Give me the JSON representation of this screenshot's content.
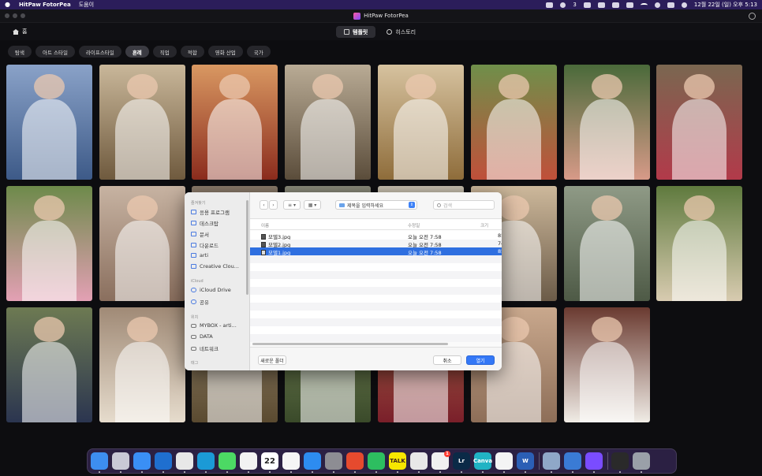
{
  "menubar": {
    "app_name": "HitPaw FotorPea",
    "help_menu": "도움이",
    "badge_count": "3",
    "datetime": "12월 22일 (일) 오후 5:13"
  },
  "titlebar": {
    "title": "HitPaw FotorPea"
  },
  "nav": {
    "home_label": "홈",
    "tabs": [
      {
        "label": "템플릿",
        "active": true
      },
      {
        "label": "히스토리",
        "active": false
      }
    ]
  },
  "categories": [
    {
      "label": "탐색",
      "active": false
    },
    {
      "label": "아트 스타일",
      "active": false
    },
    {
      "label": "라이프스타일",
      "active": false
    },
    {
      "label": "혼례",
      "active": true
    },
    {
      "label": "직업",
      "active": false
    },
    {
      "label": "적합",
      "active": false
    },
    {
      "label": "영화 산업",
      "active": false
    },
    {
      "label": "국가",
      "active": false
    }
  ],
  "templates": [
    {
      "name": "bride-blue-gown-castle",
      "color": "#8aa2c8",
      "accent": "#3d5a88"
    },
    {
      "name": "bride-white-bouquet",
      "color": "#c9b79a",
      "accent": "#6f5a3e"
    },
    {
      "name": "bride-qipao-red",
      "color": "#d99862",
      "accent": "#8b2c1d"
    },
    {
      "name": "bride-lace-hijab",
      "color": "#b9ab95",
      "accent": "#5b4d3b"
    },
    {
      "name": "bride-veil-gold",
      "color": "#d6c29f",
      "accent": "#8f6d3b"
    },
    {
      "name": "bride-garden-bouquet",
      "color": "#6f8f4a",
      "accent": "#c0503a"
    },
    {
      "name": "bride-pink-headwrap",
      "color": "#4a6a3a",
      "accent": "#d79a88"
    },
    {
      "name": "bride-floral-veil",
      "color": "#7a6750",
      "accent": "#b23a4a"
    },
    {
      "name": "bride-pink-hat",
      "color": "#6d8a4a",
      "accent": "#e3a0b4"
    },
    {
      "name": "bride-ballgown-window",
      "color": "#c7b3a2",
      "accent": "#8a6f5e"
    },
    {
      "name": "bride-hidden-1",
      "color": "#8a7a6a",
      "accent": "#4a3a2a"
    },
    {
      "name": "bride-hidden-2",
      "color": "#8a8a7a",
      "accent": "#4a4a3a"
    },
    {
      "name": "bride-hidden-3",
      "color": "#c8c0b0",
      "accent": "#7a6a5a"
    },
    {
      "name": "groom-beige-suit",
      "color": "#cdb89b",
      "accent": "#6b5b48"
    },
    {
      "name": "groom-wedding-guests",
      "color": "#8f9a86",
      "accent": "#4e5a46"
    },
    {
      "name": "groom-garden-tux",
      "color": "#5f7a3e",
      "accent": "#d8cbb0"
    },
    {
      "name": "groom-navy-suit",
      "color": "#6d7a52",
      "accent": "#2b3550"
    },
    {
      "name": "bride-lace-veil-2",
      "color": "#a08a76",
      "accent": "#e6dccd"
    },
    {
      "name": "groom-hidden-4",
      "color": "#9a8a70",
      "accent": "#5a4a30"
    },
    {
      "name": "groom-hidden-5",
      "color": "#7a8a5a",
      "accent": "#3a4a2a"
    },
    {
      "name": "bride-indian-red",
      "color": "#a86a4a",
      "accent": "#7a1f2a"
    },
    {
      "name": "bride-offshoulder-tiara",
      "color": "#c9a88d",
      "accent": "#8d6e58"
    },
    {
      "name": "bride-kimono-temple",
      "color": "#6a3a30",
      "accent": "#f0ece6"
    }
  ],
  "file_dialog": {
    "sidebar": {
      "favorites_header": "즐겨찾기",
      "favorites": [
        "응용 프로그램",
        "데스크탑",
        "문서",
        "다운로드",
        "arti",
        "Creative Clou..."
      ],
      "icloud_header": "iCloud",
      "icloud": [
        "iCloud Drive",
        "공유"
      ],
      "locations_header": "위치",
      "locations": [
        "MYBOX - arti...",
        "DATA",
        "네트워크"
      ],
      "tags_header": "태그"
    },
    "folder_select": "제목을 입력하세요",
    "search_placeholder": "검색",
    "columns": {
      "name": "이름",
      "date": "수정일",
      "size": "크기"
    },
    "files": [
      {
        "name": "모델3.jpg",
        "date": "오늘 오전 7:58",
        "size": "85",
        "selected": false
      },
      {
        "name": "모델2.jpg",
        "date": "오늘 오전 7:58",
        "size": "74",
        "selected": false
      },
      {
        "name": "모델1.jpg",
        "date": "오늘 오전 7:58",
        "size": "85",
        "selected": true
      }
    ],
    "new_folder_button": "새로운 폴더",
    "cancel_button": "취소",
    "open_button": "열기"
  },
  "dock": {
    "calendar_day": "22",
    "badge": "1",
    "apps": [
      {
        "name": "finder",
        "color": "#3d8ef0"
      },
      {
        "name": "launchpad",
        "color": "#c9c9d6"
      },
      {
        "name": "safari",
        "color": "#3a8ff5"
      },
      {
        "name": "bird-app",
        "color": "#1f6fcf"
      },
      {
        "name": "chrome",
        "color": "#e8e8e8"
      },
      {
        "name": "edge",
        "color": "#1b9ad6"
      },
      {
        "name": "messages",
        "color": "#4cd964"
      },
      {
        "name": "photos",
        "color": "#f2f2f2"
      },
      {
        "name": "calendar",
        "color": "#ffffff"
      },
      {
        "name": "reminders",
        "color": "#f5f5f5"
      },
      {
        "name": "app-store",
        "color": "#2d8cf0"
      },
      {
        "name": "system-settings",
        "color": "#8d8d93"
      },
      {
        "name": "anydesk",
        "color": "#e64a2e"
      },
      {
        "name": "evernote",
        "color": "#2dbe60"
      },
      {
        "name": "kakaotalk",
        "color": "#f7e600"
      },
      {
        "name": "istat",
        "color": "#e8e8e8"
      },
      {
        "name": "tasks",
        "color": "#f0f0f0"
      },
      {
        "name": "lightroom",
        "color": "#0b2a47"
      },
      {
        "name": "canva",
        "color": "#21b3c4"
      },
      {
        "name": "arc",
        "color": "#f4f4f4"
      },
      {
        "name": "word",
        "color": "#2b5fb5"
      },
      {
        "name": "preview",
        "color": "#8fa8c8"
      },
      {
        "name": "quicklook",
        "color": "#3a7bd5"
      },
      {
        "name": "fotorpea",
        "color": "#7a4cff"
      },
      {
        "name": "fotorpea-doc",
        "color": "#2a2a2a"
      },
      {
        "name": "trash",
        "color": "#9aa0a8"
      }
    ],
    "dock_text": {
      "kakaotalk": "TALK",
      "lightroom": "Lr",
      "canva": "Canva",
      "word": "W"
    }
  }
}
